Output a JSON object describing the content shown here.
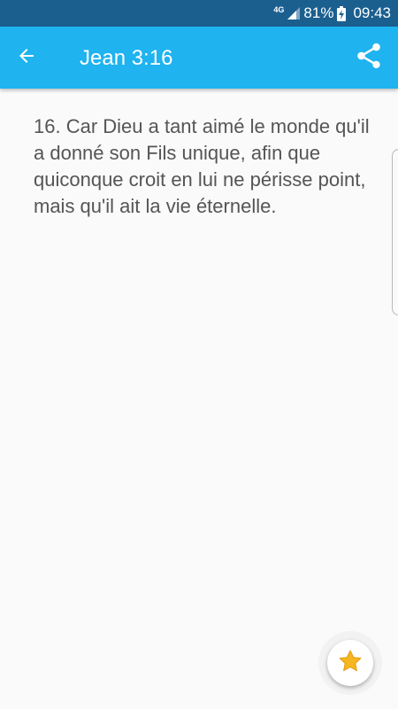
{
  "status_bar": {
    "network_type": "4G",
    "battery_percent": "81%",
    "time": "09:43",
    "signal_icon": "cell-signal-icon",
    "battery_icon": "battery-charging-icon"
  },
  "app_bar": {
    "title": "Jean 3:16",
    "back_icon": "arrow-left-icon",
    "share_icon": "share-icon",
    "color": "#1fb3f0"
  },
  "verse": {
    "text": "16. Car Dieu a tant aimé le monde qu'il a donné son Fils unique, afin que quiconque croit en lui ne périsse point, mais qu'il ait la vie éternelle."
  },
  "fab": {
    "icon": "star-icon",
    "star_color": "#f5b61f"
  },
  "colors": {
    "status_bar": "#1b5f8f",
    "background": "#fafafa",
    "text": "#555555"
  }
}
